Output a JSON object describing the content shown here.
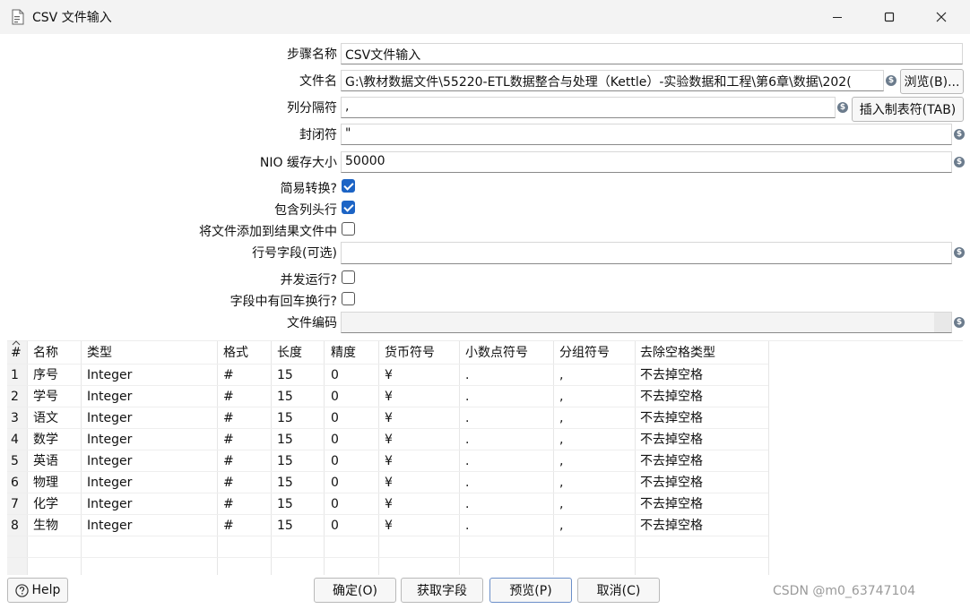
{
  "window": {
    "title": "CSV 文件输入"
  },
  "form": {
    "step_name_label": "步骤名称",
    "step_name_value": "CSV文件输入",
    "filename_label": "文件名",
    "filename_value": "G:\\教材数据文件\\55220-ETL数据整合与处理（Kettle）-实验数据和工程\\第6章\\数据\\202(",
    "browse_label": "浏览(B)...",
    "delimiter_label": "列分隔符",
    "delimiter_value": ",",
    "insert_tab_label": "插入制表符(TAB)",
    "enclosure_label": "封闭符",
    "enclosure_value": "\"",
    "nio_label": "NIO 缓存大小",
    "nio_value": "50000",
    "lazy_label": "简易转换?",
    "lazy_checked": true,
    "header_label": "包含列头行",
    "header_checked": true,
    "add_result_label": "将文件添加到结果文件中",
    "add_result_checked": false,
    "rownum_label": "行号字段(可选)",
    "rownum_value": "",
    "parallel_label": "并发运行?",
    "parallel_checked": false,
    "newline_label": "字段中有回车换行?",
    "newline_checked": false,
    "encoding_label": "文件编码",
    "encoding_value": ""
  },
  "table": {
    "columns": [
      "#",
      "名称",
      "类型",
      "格式",
      "长度",
      "精度",
      "货币符号",
      "小数点符号",
      "分组符号",
      "去除空格类型"
    ],
    "rows": [
      [
        "1",
        "序号",
        "Integer",
        "#",
        "15",
        "0",
        "¥",
        ".",
        ",",
        "不去掉空格"
      ],
      [
        "2",
        "学号",
        "Integer",
        "#",
        "15",
        "0",
        "¥",
        ".",
        ",",
        "不去掉空格"
      ],
      [
        "3",
        "语文",
        "Integer",
        "#",
        "15",
        "0",
        "¥",
        ".",
        ",",
        "不去掉空格"
      ],
      [
        "4",
        "数学",
        "Integer",
        "#",
        "15",
        "0",
        "¥",
        ".",
        ",",
        "不去掉空格"
      ],
      [
        "5",
        "英语",
        "Integer",
        "#",
        "15",
        "0",
        "¥",
        ".",
        ",",
        "不去掉空格"
      ],
      [
        "6",
        "物理",
        "Integer",
        "#",
        "15",
        "0",
        "¥",
        ".",
        ",",
        "不去掉空格"
      ],
      [
        "7",
        "化学",
        "Integer",
        "#",
        "15",
        "0",
        "¥",
        ".",
        ",",
        "不去掉空格"
      ],
      [
        "8",
        "生物",
        "Integer",
        "#",
        "15",
        "0",
        "¥",
        ".",
        ",",
        "不去掉空格"
      ]
    ]
  },
  "buttons": {
    "help": "Help",
    "ok": "确定(O)",
    "get_fields": "获取字段",
    "preview": "预览(P)",
    "cancel": "取消(C)"
  },
  "watermark": "CSDN @m0_63747104",
  "colors": {
    "accent": "#1c64c5",
    "titlebar": "#f3f3f3"
  }
}
